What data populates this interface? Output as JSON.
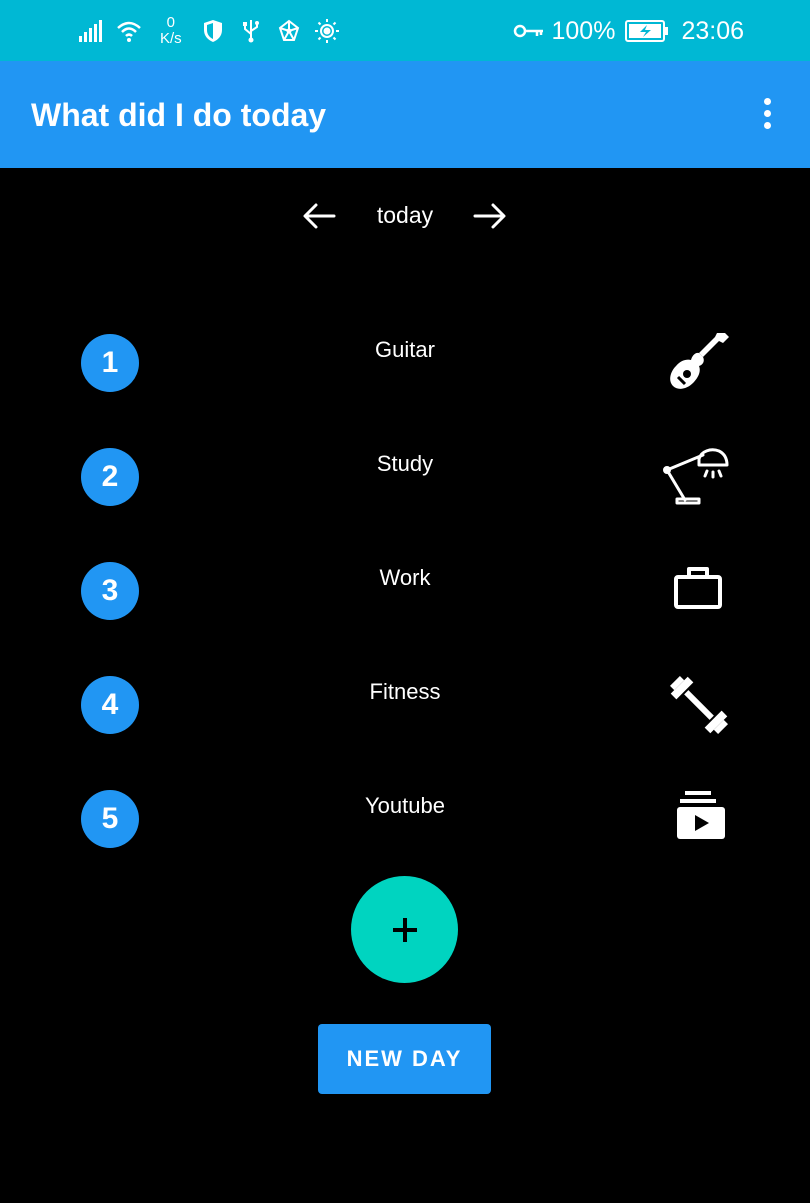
{
  "status_bar": {
    "net_speed_value": "0",
    "net_speed_unit": "K/s",
    "battery_percent": "100%",
    "time": "23:06",
    "icons": [
      "signal-icon",
      "wifi-icon",
      "shield-icon",
      "usb-icon",
      "share-icon",
      "brightness-icon",
      "key-icon",
      "battery-icon"
    ]
  },
  "app_bar": {
    "title": "What did I do today"
  },
  "date_nav": {
    "label": "today",
    "prev_icon": "arrow-left-icon",
    "next_icon": "arrow-right-icon"
  },
  "activities": [
    {
      "number": "1",
      "label": "Guitar",
      "icon": "guitar-icon"
    },
    {
      "number": "2",
      "label": "Study",
      "icon": "desk-lamp-icon"
    },
    {
      "number": "3",
      "label": "Work",
      "icon": "briefcase-icon"
    },
    {
      "number": "4",
      "label": "Fitness",
      "icon": "dumbbell-icon"
    },
    {
      "number": "5",
      "label": "Youtube",
      "icon": "video-library-icon"
    }
  ],
  "fab": {
    "icon": "plus-icon"
  },
  "new_day_button": {
    "label": "NEW DAY"
  },
  "colors": {
    "status_bar": "#00b8d4",
    "app_bar": "#2196f3",
    "badge": "#2196f3",
    "fab": "#00d4c0",
    "background": "#000000"
  }
}
